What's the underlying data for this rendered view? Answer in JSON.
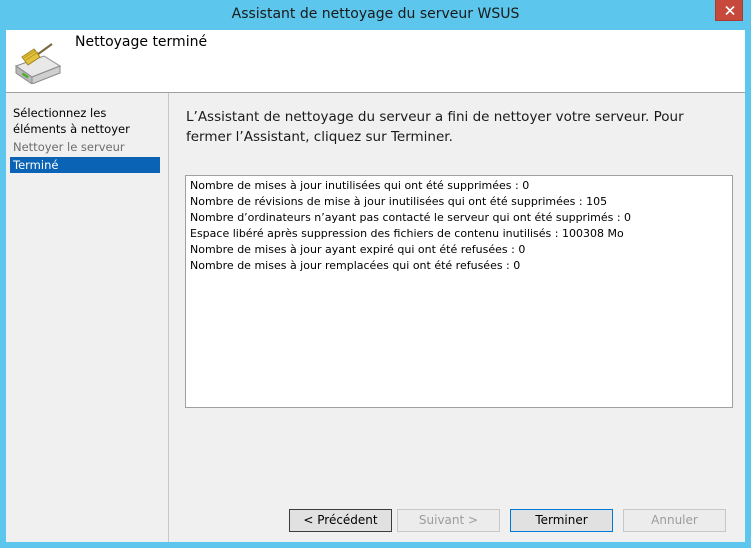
{
  "window": {
    "title": "Assistant de nettoyage du serveur WSUS"
  },
  "header": {
    "title": "Nettoyage terminé",
    "icon": "server-cleanup-icon"
  },
  "nav": {
    "items": [
      {
        "label": "Sélectionnez les éléments à nettoyer",
        "state": "normal"
      },
      {
        "label": "Nettoyer le serveur",
        "state": "disabled"
      },
      {
        "label": "Terminé",
        "state": "selected"
      }
    ]
  },
  "main": {
    "intro": "L’Assistant de nettoyage du serveur a fini de nettoyer votre serveur. Pour fermer l’Assistant, cliquez sur Terminer.",
    "results": [
      "Nombre de mises à jour inutilisées qui ont été supprimées : 0",
      "Nombre de révisions de mise à jour inutilisées qui ont été supprimées : 105",
      "Nombre d’ordinateurs n’ayant pas contacté le serveur qui ont été supprimés : 0",
      "Espace libéré après suppression des fichiers de contenu inutilisés : 100308 Mo",
      "Nombre de mises à jour ayant expiré qui ont été refusées : 0",
      "Nombre de mises à jour remplacées qui ont été refusées : 0"
    ]
  },
  "buttons": {
    "previous": "< Précédent",
    "next": "Suivant >",
    "finish": "Terminer",
    "cancel": "Annuler"
  },
  "colors": {
    "frame": "#5cc6ec",
    "selection": "#0a63b4",
    "close": "#c7493b"
  }
}
